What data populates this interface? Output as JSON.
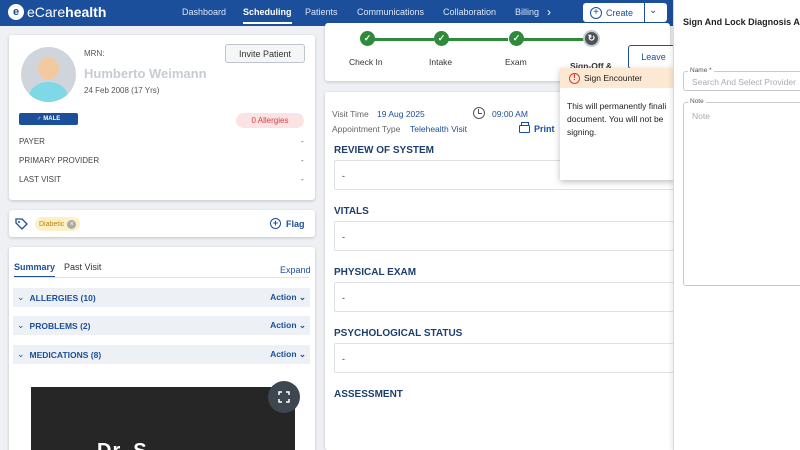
{
  "nav": {
    "logo_text_prefix": "eCare",
    "logo_text_suffix": "health",
    "items": [
      "Dashboard",
      "Scheduling",
      "Patients",
      "Communications",
      "Collaboration",
      "Billing"
    ],
    "create_label": "Create"
  },
  "patient": {
    "mrn_label": "MRN:",
    "name": "Humberto Weimann",
    "dob": "24 Feb 2008 (17 Yrs)",
    "invite_label": "Invite Patient",
    "gender": "MALE",
    "allergies_badge": "0 Allergies",
    "fields": [
      {
        "label": "PAYER",
        "value": "-"
      },
      {
        "label": "PRIMARY PROVIDER",
        "value": "-"
      },
      {
        "label": "LAST VISIT",
        "value": "-"
      }
    ]
  },
  "tags": {
    "items": [
      "Diabetic"
    ],
    "flag_label": "Flag"
  },
  "summary": {
    "tabs": [
      "Summary",
      "Past Visit"
    ],
    "expand_label": "Expand",
    "sections": [
      {
        "label": "ALLERGIES (10)",
        "action": "Action"
      },
      {
        "label": "PROBLEMS (2)",
        "action": "Action"
      },
      {
        "label": "MEDICATIONS (8)",
        "action": "Action"
      }
    ],
    "video_text": "Dr. S"
  },
  "progress": {
    "steps": [
      "Check In",
      "Intake",
      "Exam",
      "Sign-Off &"
    ],
    "leave_label": "Leave"
  },
  "visit": {
    "visit_time_label": "Visit Time",
    "visit_date": "19 Aug 2025",
    "visit_clock": "09:00 AM",
    "appt_type_label": "Appointment Type",
    "appt_type": "Telehealth Visit",
    "print_label": "Print",
    "sections": [
      {
        "title": "REVIEW OF SYSTEM",
        "value": "-"
      },
      {
        "title": "VITALS",
        "value": "-"
      },
      {
        "title": "PHYSICAL EXAM",
        "value": "-"
      },
      {
        "title": "PSYCHOLOGICAL STATUS",
        "value": "-"
      },
      {
        "title": "ASSESSMENT",
        "value": ""
      }
    ]
  },
  "popover": {
    "title": "Sign Encounter",
    "line1": "This will permanently finali",
    "line2": "document. You will not be",
    "line3": "signing."
  },
  "drawer": {
    "title": "Sign And Lock Diagnosis A",
    "name_label": "Name *",
    "name_placeholder": "Search And Select Provider",
    "note_label": "Note",
    "note_placeholder": "Note"
  },
  "colors": {
    "brand": "#1b4f9c",
    "success": "#2f8a3a",
    "danger": "#d94040"
  }
}
